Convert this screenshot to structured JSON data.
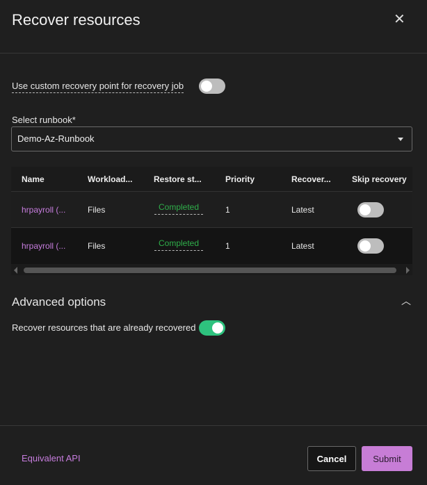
{
  "dialog": {
    "title": "Recover resources"
  },
  "custom_point": {
    "label": "Use custom recovery point for recovery job",
    "enabled": false
  },
  "runbook": {
    "label": "Select runbook",
    "required_marker": "*",
    "value": "Demo-Az-Runbook"
  },
  "table": {
    "headers": [
      "Name",
      "Workload...",
      "Restore st...",
      "Priority",
      "Recover...",
      "Skip recovery"
    ],
    "rows": [
      {
        "name": "hrpayroll (...",
        "workload": "Files",
        "status": "Completed",
        "priority": "1",
        "recover": "Latest",
        "skip": false
      },
      {
        "name": "hrpayroll (...",
        "workload": "Files",
        "status": "Completed",
        "priority": "1",
        "recover": "Latest",
        "skip": false
      }
    ]
  },
  "advanced": {
    "title": "Advanced options",
    "recover_already_label": "Recover resources that are already recovered",
    "recover_already": true
  },
  "footer": {
    "api_link": "Equivalent API",
    "cancel": "Cancel",
    "submit": "Submit"
  },
  "colors": {
    "accent": "#c77dde",
    "success": "#2fae4a",
    "toggle_on": "#2ec27e"
  }
}
